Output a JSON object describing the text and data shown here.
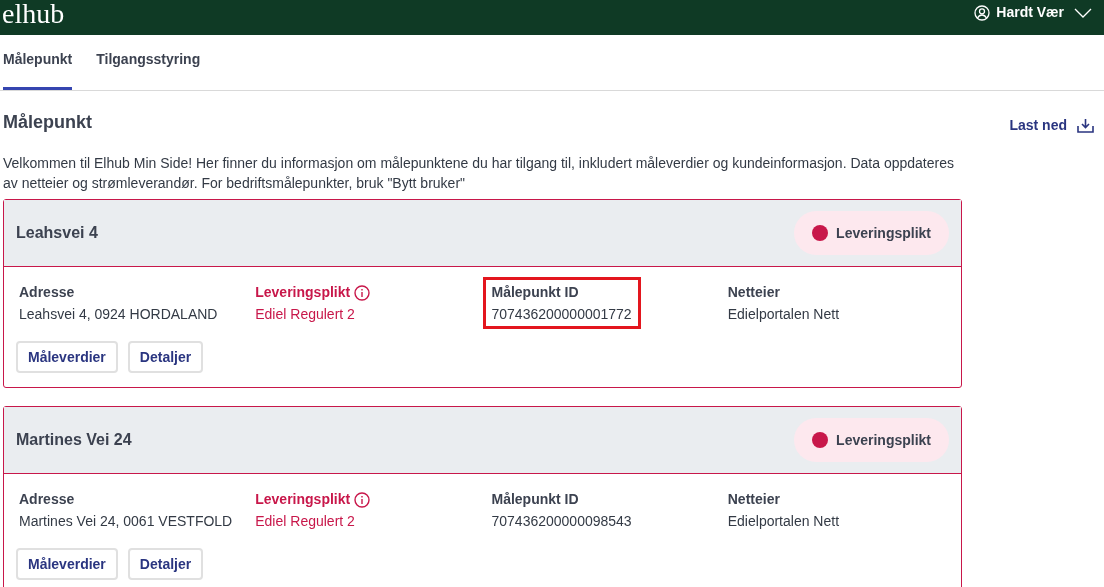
{
  "header": {
    "logo": "elhub",
    "user": "Hardt Vær"
  },
  "tabs": [
    {
      "label": "Målepunkt",
      "selected": true
    },
    {
      "label": "Tilgangsstyring",
      "selected": false
    }
  ],
  "page": {
    "title": "Målepunkt",
    "download": "Last ned",
    "intro": "Velkommen til Elhub Min Side! Her finner du informasjon om målepunktene du har tilgang til, inkludert måleverdier og kundeinformasjon. Data oppdateres av netteier og strømleverandør. For bedriftsmålepunkter, bruk \"Bytt bruker\""
  },
  "cards": [
    {
      "title": "Leahsvei 4",
      "badge": "Leveringsplikt",
      "color": "#c8174a",
      "fields": [
        {
          "label": "Adresse",
          "value": "Leahsvei 4, 0924 HORDALAND",
          "kind": "plain",
          "highlighted": false
        },
        {
          "label": "Leveringsplikt",
          "value": "Ediel Regulert 2",
          "kind": "alert",
          "highlighted": false
        },
        {
          "label": "Målepunkt ID",
          "value": "707436200000001772",
          "kind": "plain",
          "highlighted": true
        },
        {
          "label": "Netteier",
          "value": "Edielportalen Nett",
          "kind": "plain",
          "highlighted": false
        }
      ],
      "buttons": [
        "Måleverdier",
        "Detaljer"
      ]
    },
    {
      "title": "Martines Vei 24",
      "badge": "Leveringsplikt",
      "color": "#c8174a",
      "fields": [
        {
          "label": "Adresse",
          "value": "Martines Vei 24, 0061 VESTFOLD",
          "kind": "plain",
          "highlighted": false
        },
        {
          "label": "Leveringsplikt",
          "value": "Ediel Regulert 2",
          "kind": "alert",
          "highlighted": false
        },
        {
          "label": "Målepunkt ID",
          "value": "707436200000098543",
          "kind": "plain",
          "highlighted": false
        },
        {
          "label": "Netteier",
          "value": "Edielportalen Nett",
          "kind": "plain",
          "highlighted": false
        }
      ],
      "buttons": [
        "Måleverdier",
        "Detaljer"
      ]
    }
  ]
}
